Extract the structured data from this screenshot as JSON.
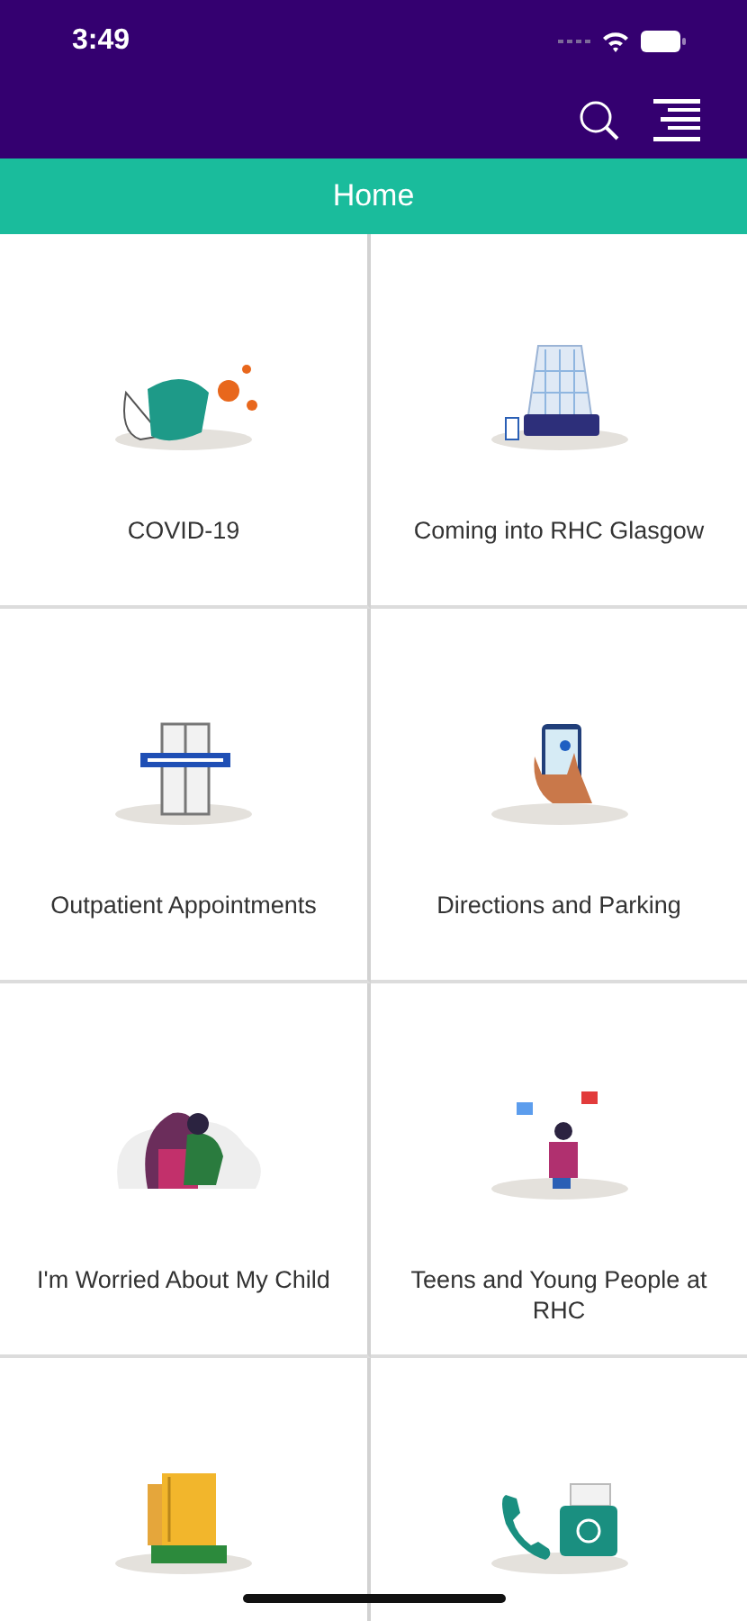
{
  "status_bar": {
    "time": "3:49"
  },
  "header": {
    "title": "Home"
  },
  "tiles": [
    {
      "kind": "mask",
      "label": "COVID-19"
    },
    {
      "kind": "building",
      "label": "Coming into RHC Glasgow"
    },
    {
      "kind": "door",
      "label": "Outpatient Appointments"
    },
    {
      "kind": "phone",
      "label": "Directions and Parking"
    },
    {
      "kind": "family",
      "label": "I'm Worried About My Child"
    },
    {
      "kind": "teen",
      "label": "Teens and Young People at RHC"
    },
    {
      "kind": "books"
    },
    {
      "kind": "contact"
    }
  ]
}
